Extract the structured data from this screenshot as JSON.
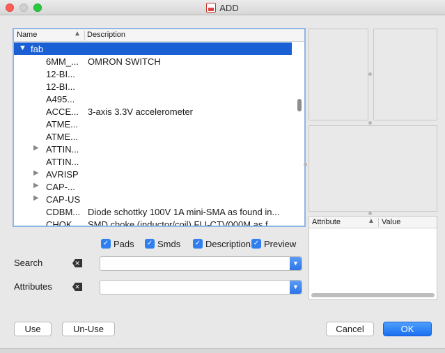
{
  "window": {
    "title": "ADD"
  },
  "tree": {
    "columns": {
      "name": "Name",
      "description": "Description"
    },
    "group": "fab",
    "rows": [
      {
        "name": "6MM_...",
        "desc": "OMRON SWITCH",
        "expandable": false
      },
      {
        "name": "12-BI...",
        "desc": "",
        "expandable": false
      },
      {
        "name": "12-BI...",
        "desc": "",
        "expandable": false
      },
      {
        "name": "A495...",
        "desc": "",
        "expandable": false
      },
      {
        "name": "ACCE...",
        "desc": "3-axis 3.3V accelerometer",
        "expandable": false
      },
      {
        "name": "ATME...",
        "desc": "",
        "expandable": false
      },
      {
        "name": "ATME...",
        "desc": "",
        "expandable": false
      },
      {
        "name": "ATTIN...",
        "desc": "",
        "expandable": true
      },
      {
        "name": "ATTIN...",
        "desc": "",
        "expandable": false
      },
      {
        "name": "AVRISP",
        "desc": "",
        "expandable": true
      },
      {
        "name": "CAP-...",
        "desc": "",
        "expandable": true
      },
      {
        "name": "CAP-US",
        "desc": "",
        "expandable": true
      },
      {
        "name": "CDBM...",
        "desc": "Diode schottky 100V 1A mini-SMA as found in...",
        "expandable": false
      },
      {
        "name": "CHOK...",
        "desc": "SMD choke (inductor/coil) FLI-CTV000M as f...",
        "expandable": false
      }
    ]
  },
  "attributes_table": {
    "col_attribute": "Attribute",
    "col_value": "Value"
  },
  "checkboxes": [
    {
      "label": "Pads",
      "checked": true
    },
    {
      "label": "Smds",
      "checked": true
    },
    {
      "label": "Description",
      "checked": true
    },
    {
      "label": "Preview",
      "checked": true
    }
  ],
  "search": {
    "label": "Search",
    "value": ""
  },
  "attributes_filter": {
    "label": "Attributes",
    "value": ""
  },
  "buttons": {
    "use": "Use",
    "unuse": "Un-Use",
    "cancel": "Cancel",
    "ok": "OK"
  },
  "icons": {
    "close": "clear-field-icon",
    "dropdown": "chevron-down-icon"
  },
  "colors": {
    "selection": "#1a5fd4",
    "accent": "#2f7ff0"
  }
}
